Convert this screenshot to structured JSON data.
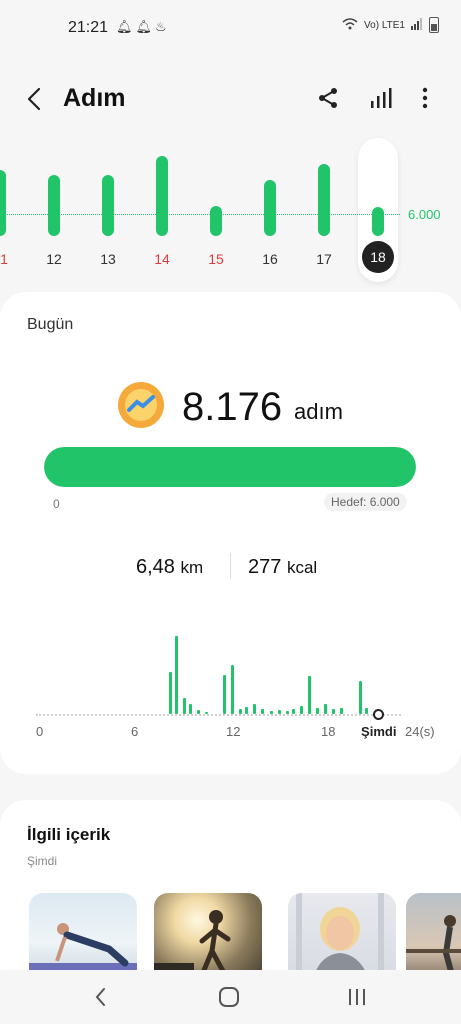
{
  "status_bar": {
    "time": "21:21",
    "notification_icons": [
      "bell-icon",
      "bell-icon",
      "app-icon"
    ],
    "network": "Vo) LTE1"
  },
  "header": {
    "title": "Adım",
    "icons": [
      "back-arrow-icon",
      "share-icon",
      "bar-chart-icon",
      "more-vert-icon"
    ]
  },
  "daily_chart": {
    "goal_label": "6.000",
    "days": [
      {
        "label": "1",
        "steps": 7800,
        "red": true
      },
      {
        "label": "12",
        "steps": 7200,
        "red": false
      },
      {
        "label": "13",
        "steps": 7200,
        "red": false
      },
      {
        "label": "14",
        "steps": 9500,
        "red": true
      },
      {
        "label": "15",
        "steps": 3600,
        "red": true
      },
      {
        "label": "16",
        "steps": 6600,
        "red": false
      },
      {
        "label": "17",
        "steps": 8600,
        "red": false
      },
      {
        "label": "18",
        "steps": 3400,
        "red": false,
        "selected": true
      }
    ]
  },
  "today": {
    "label": "Bugün",
    "steps": "8.176",
    "unit": "adım",
    "progress_fraction": 1.0,
    "progress_min": "0",
    "goal_text": "Hedef: 6.000",
    "distance_value": "6,48",
    "distance_unit": "km",
    "energy_value": "277",
    "energy_unit": "kcal"
  },
  "hourly_chart": {
    "x_labels": [
      "0",
      "6",
      "12",
      "18",
      "24(s)"
    ],
    "now_label": "Şimdi",
    "bars": [
      {
        "hour": 8.2,
        "value": 42
      },
      {
        "hour": 8.6,
        "value": 78
      },
      {
        "hour": 9.1,
        "value": 16
      },
      {
        "hour": 9.5,
        "value": 10
      },
      {
        "hour": 10.0,
        "value": 4
      },
      {
        "hour": 10.5,
        "value": 2
      },
      {
        "hour": 11.6,
        "value": 39
      },
      {
        "hour": 12.1,
        "value": 49
      },
      {
        "hour": 12.6,
        "value": 5
      },
      {
        "hour": 13.0,
        "value": 7
      },
      {
        "hour": 13.5,
        "value": 10
      },
      {
        "hour": 14.0,
        "value": 5
      },
      {
        "hour": 14.6,
        "value": 3
      },
      {
        "hour": 15.1,
        "value": 4
      },
      {
        "hour": 15.6,
        "value": 3
      },
      {
        "hour": 16.0,
        "value": 5
      },
      {
        "hour": 16.5,
        "value": 8
      },
      {
        "hour": 17.0,
        "value": 38
      },
      {
        "hour": 17.5,
        "value": 6
      },
      {
        "hour": 18.0,
        "value": 10
      },
      {
        "hour": 18.5,
        "value": 5
      },
      {
        "hour": 19.0,
        "value": 6
      },
      {
        "hour": 20.2,
        "value": 33
      },
      {
        "hour": 20.6,
        "value": 6
      }
    ],
    "now_hour": 21.35
  },
  "related": {
    "title": "İlgili içerik",
    "subtitle": "Şimdi",
    "thumbs": [
      "pushup-workout",
      "running-sunset",
      "smiling-woman",
      "outdoor-stretch"
    ]
  },
  "navbar": {
    "icons": [
      "back-nav-icon",
      "home-nav-icon",
      "recents-nav-icon"
    ]
  }
}
